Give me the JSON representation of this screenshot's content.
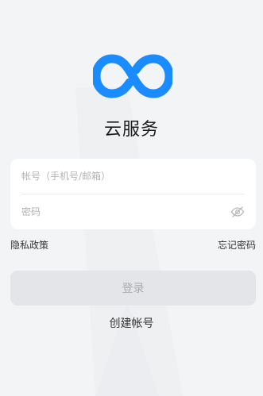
{
  "app": {
    "title": "云服务",
    "brand_color": "#1a8cff",
    "logo_icon": "infinity-cloud-logo"
  },
  "login_form": {
    "account_placeholder": "帐号（手机号/邮箱）",
    "account_value": "",
    "password_placeholder": "密码",
    "password_value": "",
    "password_toggle_icon": "eye-off-icon"
  },
  "links": {
    "privacy": "隐私政策",
    "forgot_password": "忘记密码"
  },
  "actions": {
    "login_label": "登录",
    "create_account_label": "创建帐号"
  }
}
